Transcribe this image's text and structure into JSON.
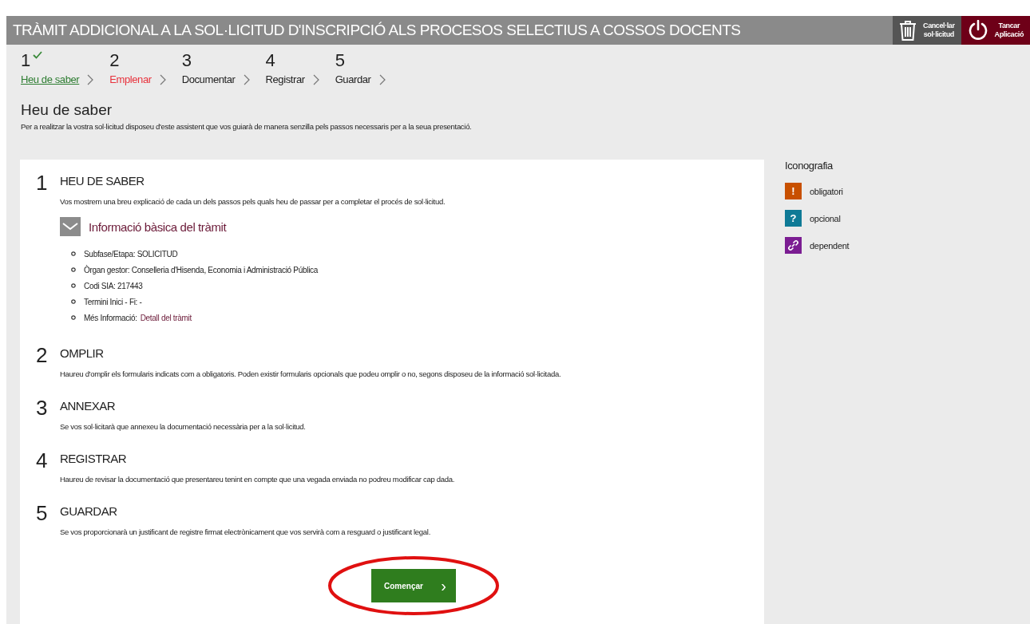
{
  "header": {
    "title": "TRÀMIT ADDICIONAL A LA SOL·LICITUD D'INSCRIPCIÓ ALS PROCESOS SELECTIUS A COSSOS DOCENTS",
    "actions": [
      {
        "kind": "cancel",
        "label": [
          "Cancel·lar",
          "sol·licitud"
        ]
      },
      {
        "kind": "close",
        "label": [
          "Tancar",
          "Aplicació"
        ]
      }
    ]
  },
  "steps": [
    {
      "number": "1",
      "label": "Heu de saber",
      "completed": true,
      "selected": false
    },
    {
      "number": "2",
      "label": "Emplenar",
      "completed": false,
      "selected": true
    },
    {
      "number": "3",
      "label": "Documentar",
      "completed": false,
      "selected": false
    },
    {
      "number": "4",
      "label": "Registrar",
      "completed": false,
      "selected": false
    },
    {
      "number": "5",
      "label": "Guardar",
      "completed": false,
      "selected": false
    }
  ],
  "page": {
    "title": "Heu de saber",
    "description": "Per a realitzar la vostra sol·licitud disposeu d'este assistent que vos guiarà de manera senzilla pels passos necessaris per a la seua presentació."
  },
  "sections": [
    {
      "number": "1",
      "title": "HEU DE SABER",
      "text": "Vos mostrem una breu explicació de cada un dels passos pels quals heu de passar per a completar el procés de sol·licitud.",
      "info": {
        "title": "Informació bàsica del tràmit",
        "expanded": true,
        "items": [
          {
            "text": "Subfase/Etapa: SOLICITUD"
          },
          {
            "text": "Òrgan gestor: Conselleria d'Hisenda, Economia i Administració Pública"
          },
          {
            "text": "Codi SIA: 217443"
          },
          {
            "text": "Termini Inici - Fi: -"
          },
          {
            "text": "Més Informació:",
            "link": "Detall del tràmit"
          }
        ]
      }
    },
    {
      "number": "2",
      "title": "OMPLIR",
      "text": "Haureu d'omplir els formularis indicats com a obligatoris. Poden existir formularis opcionals que podeu omplir o no, segons disposeu de la informació sol·licitada."
    },
    {
      "number": "3",
      "title": "ANNEXAR",
      "text": "Se vos sol·licitarà que annexeu la documentació necessària per a la sol·licitud."
    },
    {
      "number": "4",
      "title": "REGISTRAR",
      "text": "Haureu de revisar la documentació que presentareu tenint en compte que una vegada enviada no podreu modificar cap dada."
    },
    {
      "number": "5",
      "title": "GUARDAR",
      "text": "Se vos proporcionarà un justificant de registre firmat electrònicament que vos servirà com a resguard o justificant legal."
    }
  ],
  "start_button": {
    "label": "Començar",
    "glyph": "›"
  },
  "legend": {
    "title": "Iconografia",
    "items": [
      {
        "kind": "glyph",
        "glyph": "!",
        "color": "#c85000",
        "label": "obligatori"
      },
      {
        "kind": "glyph",
        "glyph": "?",
        "color": "#0f7a96",
        "label": "opcional"
      },
      {
        "kind": "link",
        "color": "#7b1d92",
        "label": "dependent"
      }
    ]
  }
}
